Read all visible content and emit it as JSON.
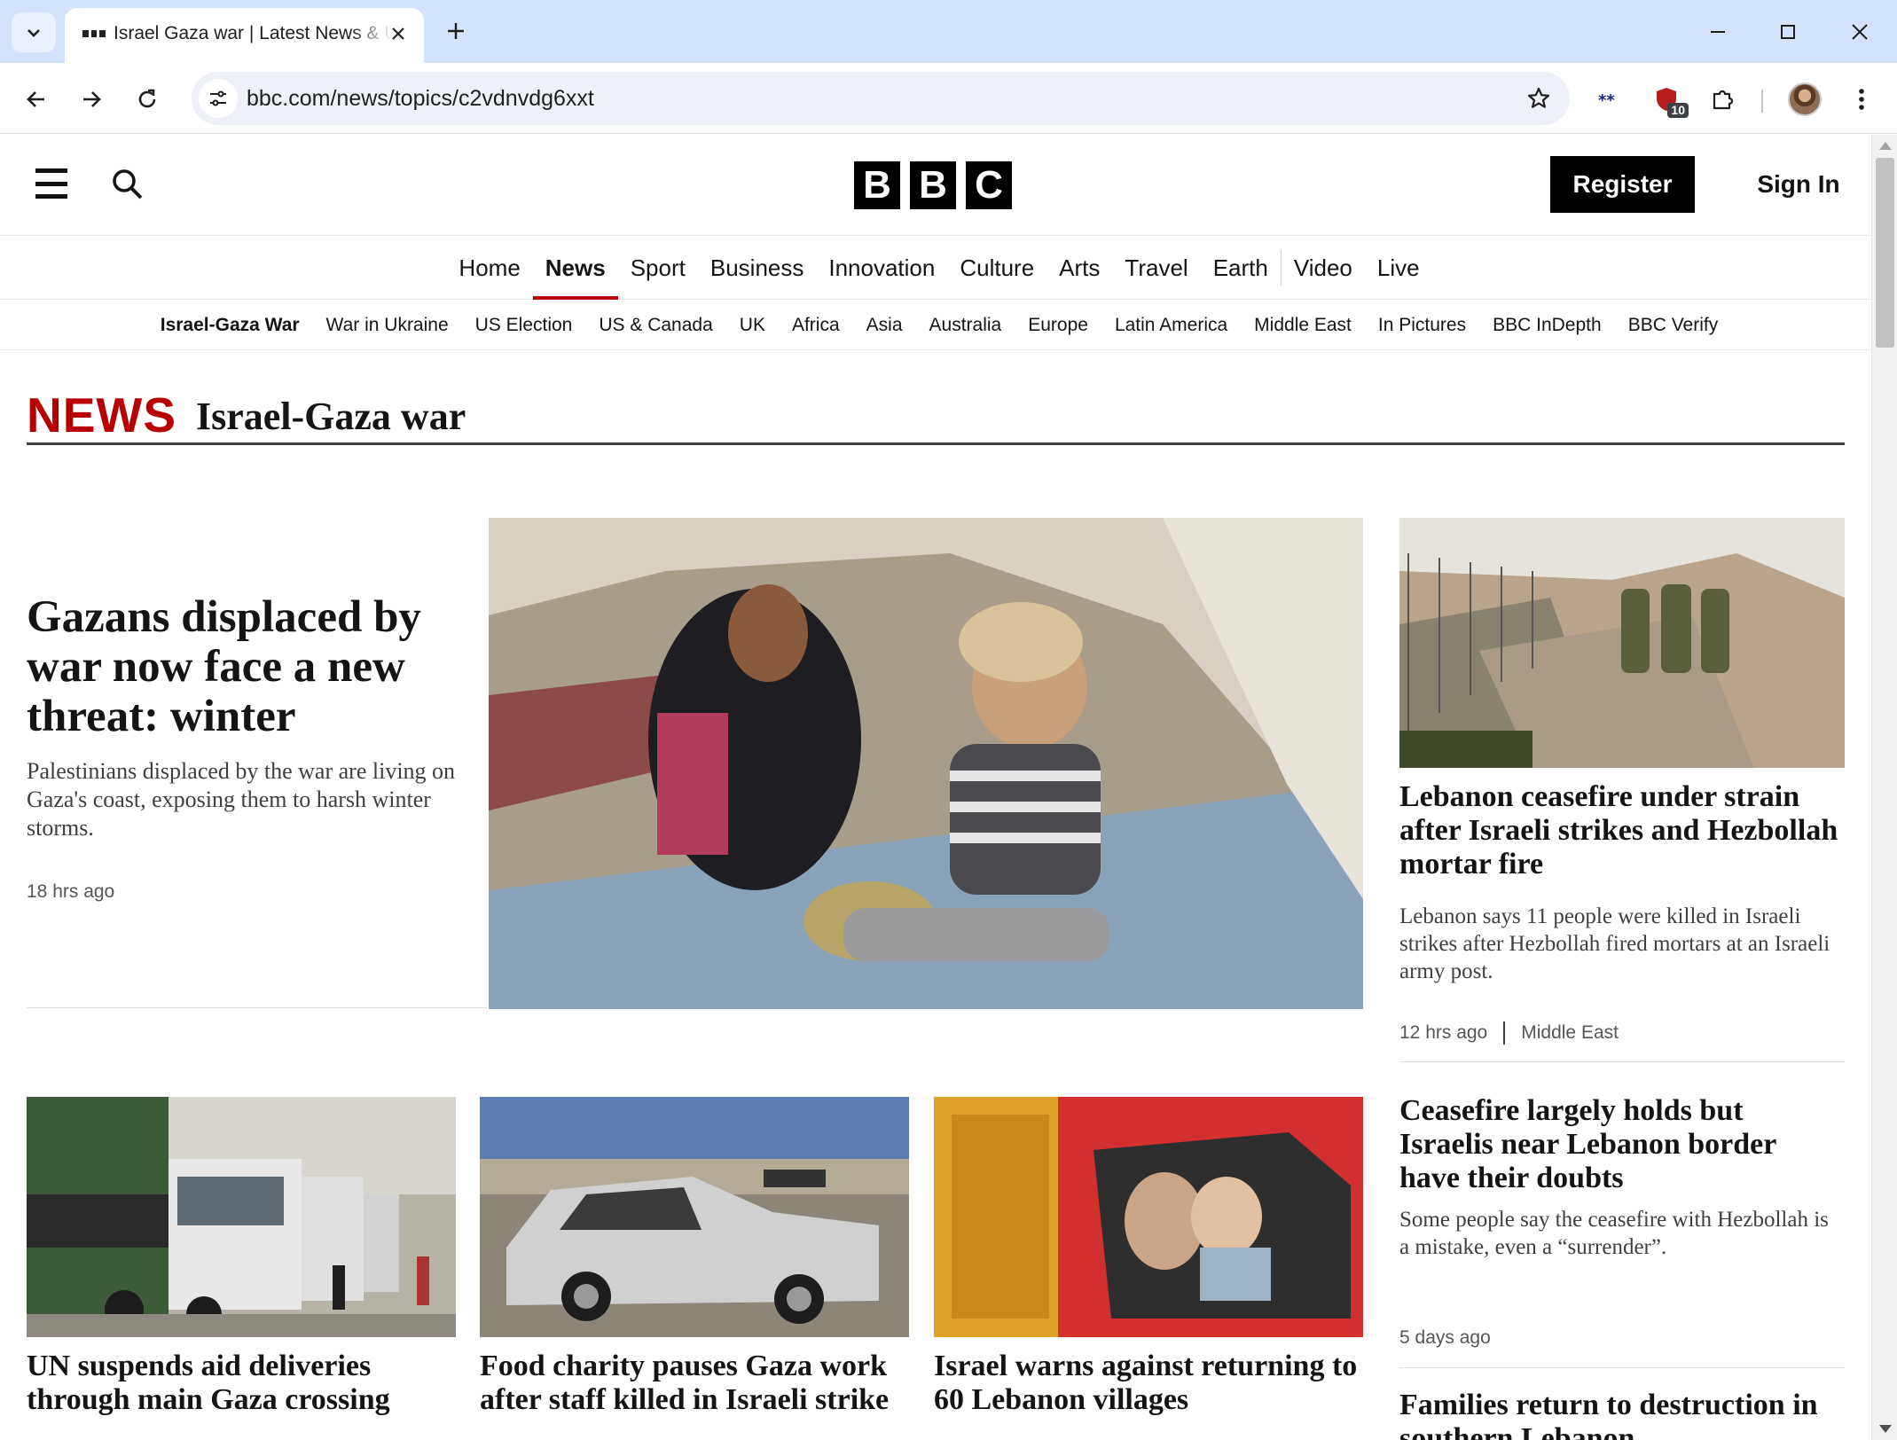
{
  "browser": {
    "tab_title": "Israel Gaza war | Latest News & Updates | BBC News",
    "url": "bbc.com/news/topics/c2vdnvdg6xxt",
    "extension_badge": "10"
  },
  "masthead": {
    "logo_letters": [
      "B",
      "B",
      "C"
    ],
    "register_label": "Register",
    "signin_label": "Sign In"
  },
  "primary_nav": {
    "items": [
      "Home",
      "News",
      "Sport",
      "Business",
      "Innovation",
      "Culture",
      "Arts",
      "Travel",
      "Earth",
      "Video",
      "Live"
    ],
    "active": "News"
  },
  "secondary_nav": {
    "items": [
      "Israel-Gaza War",
      "War in Ukraine",
      "US Election",
      "US & Canada",
      "UK",
      "Africa",
      "Asia",
      "Australia",
      "Europe",
      "Latin America",
      "Middle East",
      "In Pictures",
      "BBC InDepth",
      "BBC Verify"
    ],
    "active": "Israel-Gaza War"
  },
  "section": {
    "brand": "NEWS",
    "title": "Israel-Gaza war"
  },
  "lead": {
    "headline": "Gazans displaced by war now face a new threat: winter",
    "summary": "Palestinians displaced by the war are living on Gaza's coast, exposing them to harsh winter storms.",
    "time": "18 hrs ago"
  },
  "right_column": [
    {
      "headline": "Lebanon ceasefire under strain after Israeli strikes and Hezbollah mortar fire",
      "summary": "Lebanon says 11 people were killed in Israeli strikes after Hezbollah fired mortars at an Israeli army post.",
      "time": "12 hrs ago",
      "tag": "Middle East"
    },
    {
      "headline": "Ceasefire largely holds but Israelis near Lebanon border have their doubts",
      "summary": "Some people say the ceasefire with Hezbollah is a mistake, even a “surrender”.",
      "time": "5 days ago"
    },
    {
      "headline": "Families return to destruction in southern Lebanon"
    }
  ],
  "bottom_row": [
    {
      "headline": "UN suspends aid deliveries through main Gaza crossing"
    },
    {
      "headline": "Food charity pauses Gaza work after staff killed in Israeli strike"
    },
    {
      "headline": "Israel warns against returning to 60 Lebanon villages"
    }
  ],
  "colors": {
    "brand_red": "#b80000",
    "chrome_tabbar": "#d3e3fd",
    "omnibox": "#eef1f8"
  }
}
